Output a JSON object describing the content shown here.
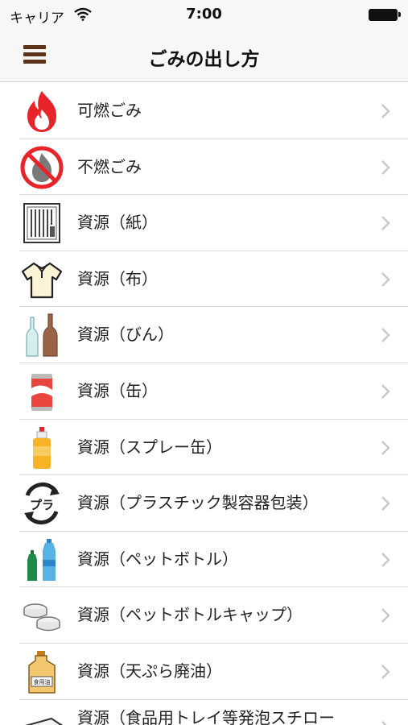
{
  "status_bar": {
    "carrier": "キャリア",
    "time": "7:00"
  },
  "nav": {
    "title": "ごみの出し方",
    "menu_icon": "hamburger-menu-icon"
  },
  "items": [
    {
      "label": "可燃ごみ",
      "icon": "flame-icon"
    },
    {
      "label": "不燃ごみ",
      "icon": "no-burn-icon"
    },
    {
      "label": "資源（紙）",
      "icon": "paper-icon"
    },
    {
      "label": "資源（布）",
      "icon": "shirt-icon"
    },
    {
      "label": "資源（びん）",
      "icon": "bottles-icon"
    },
    {
      "label": "資源（缶）",
      "icon": "can-icon"
    },
    {
      "label": "資源（スプレー缶）",
      "icon": "spray-can-icon"
    },
    {
      "label": "資源（プラスチック製容器包装）",
      "icon": "plastic-recycle-icon",
      "icon_text": "プラ"
    },
    {
      "label": "資源（ペットボトル）",
      "icon": "pet-bottle-icon"
    },
    {
      "label": "資源（ペットボトルキャップ）",
      "icon": "bottle-caps-icon"
    },
    {
      "label": "資源（天ぷら廃油）",
      "icon": "oil-container-icon",
      "icon_text": "食用油"
    },
    {
      "label": "資源（食品用トレイ等発泡スチロー",
      "icon": "food-tray-icon"
    }
  ],
  "colors": {
    "accent": "#5b3418",
    "flame": "#e8232a",
    "chevron": "#c7c7cc"
  }
}
